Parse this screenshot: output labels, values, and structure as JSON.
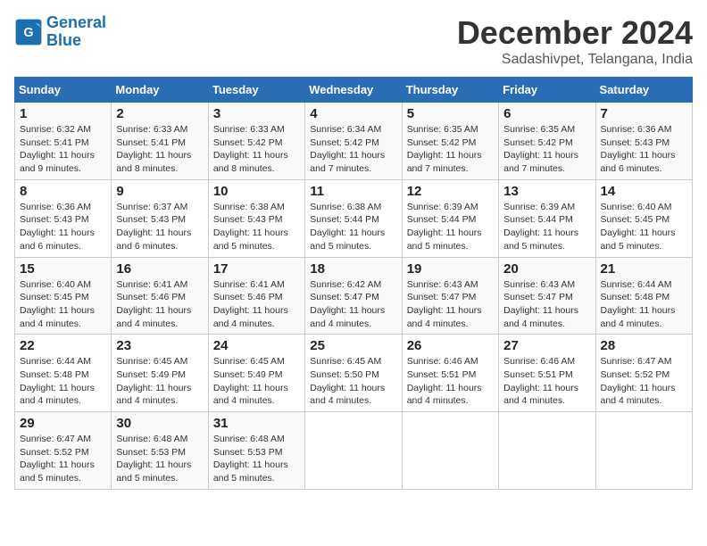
{
  "logo": {
    "line1": "General",
    "line2": "Blue"
  },
  "title": "December 2024",
  "location": "Sadashivpet, Telangana, India",
  "days_of_week": [
    "Sunday",
    "Monday",
    "Tuesday",
    "Wednesday",
    "Thursday",
    "Friday",
    "Saturday"
  ],
  "weeks": [
    [
      {
        "day": "1",
        "info": "Sunrise: 6:32 AM\nSunset: 5:41 PM\nDaylight: 11 hours\nand 9 minutes."
      },
      {
        "day": "2",
        "info": "Sunrise: 6:33 AM\nSunset: 5:41 PM\nDaylight: 11 hours\nand 8 minutes."
      },
      {
        "day": "3",
        "info": "Sunrise: 6:33 AM\nSunset: 5:42 PM\nDaylight: 11 hours\nand 8 minutes."
      },
      {
        "day": "4",
        "info": "Sunrise: 6:34 AM\nSunset: 5:42 PM\nDaylight: 11 hours\nand 7 minutes."
      },
      {
        "day": "5",
        "info": "Sunrise: 6:35 AM\nSunset: 5:42 PM\nDaylight: 11 hours\nand 7 minutes."
      },
      {
        "day": "6",
        "info": "Sunrise: 6:35 AM\nSunset: 5:42 PM\nDaylight: 11 hours\nand 7 minutes."
      },
      {
        "day": "7",
        "info": "Sunrise: 6:36 AM\nSunset: 5:43 PM\nDaylight: 11 hours\nand 6 minutes."
      }
    ],
    [
      {
        "day": "8",
        "info": "Sunrise: 6:36 AM\nSunset: 5:43 PM\nDaylight: 11 hours\nand 6 minutes."
      },
      {
        "day": "9",
        "info": "Sunrise: 6:37 AM\nSunset: 5:43 PM\nDaylight: 11 hours\nand 6 minutes."
      },
      {
        "day": "10",
        "info": "Sunrise: 6:38 AM\nSunset: 5:43 PM\nDaylight: 11 hours\nand 5 minutes."
      },
      {
        "day": "11",
        "info": "Sunrise: 6:38 AM\nSunset: 5:44 PM\nDaylight: 11 hours\nand 5 minutes."
      },
      {
        "day": "12",
        "info": "Sunrise: 6:39 AM\nSunset: 5:44 PM\nDaylight: 11 hours\nand 5 minutes."
      },
      {
        "day": "13",
        "info": "Sunrise: 6:39 AM\nSunset: 5:44 PM\nDaylight: 11 hours\nand 5 minutes."
      },
      {
        "day": "14",
        "info": "Sunrise: 6:40 AM\nSunset: 5:45 PM\nDaylight: 11 hours\nand 5 minutes."
      }
    ],
    [
      {
        "day": "15",
        "info": "Sunrise: 6:40 AM\nSunset: 5:45 PM\nDaylight: 11 hours\nand 4 minutes."
      },
      {
        "day": "16",
        "info": "Sunrise: 6:41 AM\nSunset: 5:46 PM\nDaylight: 11 hours\nand 4 minutes."
      },
      {
        "day": "17",
        "info": "Sunrise: 6:41 AM\nSunset: 5:46 PM\nDaylight: 11 hours\nand 4 minutes."
      },
      {
        "day": "18",
        "info": "Sunrise: 6:42 AM\nSunset: 5:47 PM\nDaylight: 11 hours\nand 4 minutes."
      },
      {
        "day": "19",
        "info": "Sunrise: 6:43 AM\nSunset: 5:47 PM\nDaylight: 11 hours\nand 4 minutes."
      },
      {
        "day": "20",
        "info": "Sunrise: 6:43 AM\nSunset: 5:47 PM\nDaylight: 11 hours\nand 4 minutes."
      },
      {
        "day": "21",
        "info": "Sunrise: 6:44 AM\nSunset: 5:48 PM\nDaylight: 11 hours\nand 4 minutes."
      }
    ],
    [
      {
        "day": "22",
        "info": "Sunrise: 6:44 AM\nSunset: 5:48 PM\nDaylight: 11 hours\nand 4 minutes."
      },
      {
        "day": "23",
        "info": "Sunrise: 6:45 AM\nSunset: 5:49 PM\nDaylight: 11 hours\nand 4 minutes."
      },
      {
        "day": "24",
        "info": "Sunrise: 6:45 AM\nSunset: 5:49 PM\nDaylight: 11 hours\nand 4 minutes."
      },
      {
        "day": "25",
        "info": "Sunrise: 6:45 AM\nSunset: 5:50 PM\nDaylight: 11 hours\nand 4 minutes."
      },
      {
        "day": "26",
        "info": "Sunrise: 6:46 AM\nSunset: 5:51 PM\nDaylight: 11 hours\nand 4 minutes."
      },
      {
        "day": "27",
        "info": "Sunrise: 6:46 AM\nSunset: 5:51 PM\nDaylight: 11 hours\nand 4 minutes."
      },
      {
        "day": "28",
        "info": "Sunrise: 6:47 AM\nSunset: 5:52 PM\nDaylight: 11 hours\nand 4 minutes."
      }
    ],
    [
      {
        "day": "29",
        "info": "Sunrise: 6:47 AM\nSunset: 5:52 PM\nDaylight: 11 hours\nand 5 minutes."
      },
      {
        "day": "30",
        "info": "Sunrise: 6:48 AM\nSunset: 5:53 PM\nDaylight: 11 hours\nand 5 minutes."
      },
      {
        "day": "31",
        "info": "Sunrise: 6:48 AM\nSunset: 5:53 PM\nDaylight: 11 hours\nand 5 minutes."
      },
      null,
      null,
      null,
      null
    ]
  ]
}
